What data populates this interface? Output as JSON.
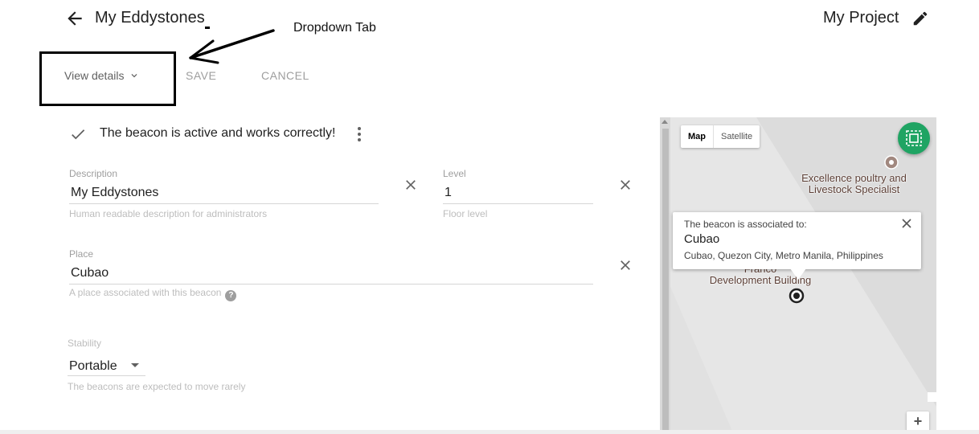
{
  "header": {
    "title": "My Eddystones",
    "project": "My Project"
  },
  "annotation": {
    "label": "Dropdown Tab"
  },
  "tabs": {
    "view_details": "View details",
    "save": "SAVE",
    "cancel": "CANCEL"
  },
  "status": {
    "text": "The beacon is active and works correctly!"
  },
  "fields": {
    "description": {
      "label": "Description",
      "value": "My Eddystones",
      "help": "Human readable description for administrators"
    },
    "level": {
      "label": "Level",
      "value": "1",
      "help": "Floor level"
    },
    "place": {
      "label": "Place",
      "value": "Cubao",
      "help": "A place associated with this beacon"
    },
    "stability": {
      "label": "Stability",
      "value": "Portable",
      "help": "The beacons are expected to move rarely"
    }
  },
  "map": {
    "type_map": "Map",
    "type_satellite": "Satellite",
    "poi_top_line1": "Excellence poultry and",
    "poi_top_line2": "Livestock Specialist",
    "poi_bottom_line1": "Franco",
    "poi_bottom_line2": "Development Building",
    "info_title": "The beacon is associated to:",
    "info_name": "Cubao",
    "info_address": "Cubao, Quezon City, Metro Manila, Philippines",
    "zoom_in": "+"
  },
  "colors": {
    "accent_green": "#1fa463",
    "text_primary": "#212121",
    "text_muted": "#9e9e9e"
  }
}
